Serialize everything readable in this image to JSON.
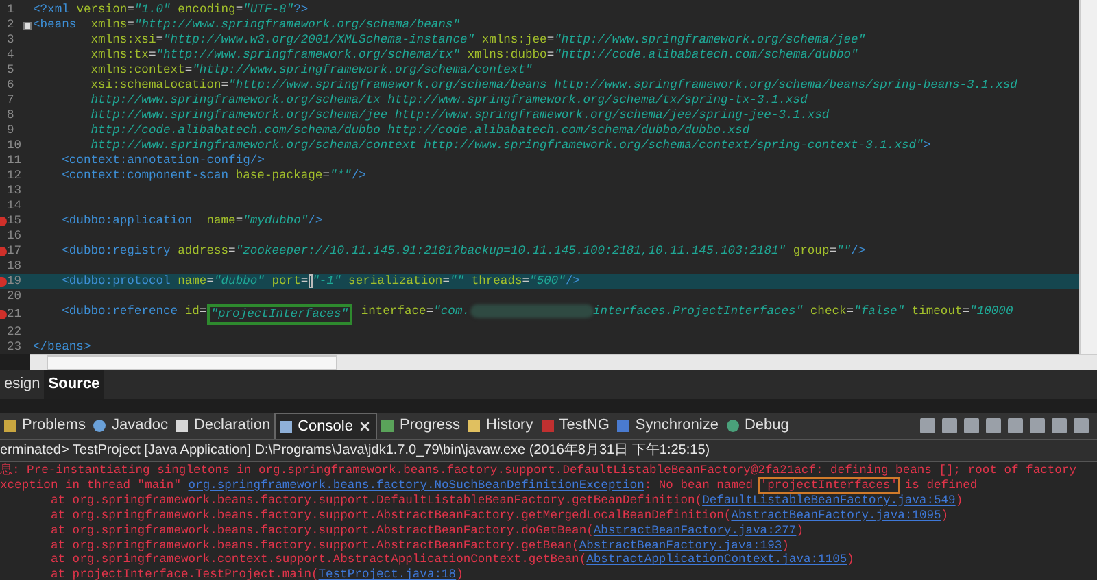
{
  "editor": {
    "lines": [
      {
        "number": "1",
        "error": false,
        "foldable": false,
        "current": false,
        "tokens": [
          {
            "kind": "tag",
            "text": "<?xml"
          },
          {
            "kind": "attr",
            "text": " version"
          },
          {
            "kind": "plain",
            "text": "="
          },
          {
            "kind": "value",
            "text": "\"1.0\""
          },
          {
            "kind": "attr",
            "text": " encoding"
          },
          {
            "kind": "plain",
            "text": "="
          },
          {
            "kind": "value",
            "text": "\"UTF-8\""
          },
          {
            "kind": "tag",
            "text": "?>"
          }
        ]
      },
      {
        "number": "2",
        "error": false,
        "foldable": true,
        "current": false,
        "tokens": [
          {
            "kind": "tag",
            "text": "<beans"
          },
          {
            "kind": "attr",
            "text": "  xmlns"
          },
          {
            "kind": "plain",
            "text": "="
          },
          {
            "kind": "value",
            "text": "\"http://www.springframework.org/schema/beans\""
          }
        ]
      },
      {
        "number": "3",
        "error": false,
        "foldable": false,
        "current": false,
        "tokens": [
          {
            "kind": "attr",
            "text": "        xmlns:xsi"
          },
          {
            "kind": "plain",
            "text": "="
          },
          {
            "kind": "value",
            "text": "\"http://www.w3.org/2001/XMLSchema-instance\""
          },
          {
            "kind": "attr",
            "text": " xmlns:jee"
          },
          {
            "kind": "plain",
            "text": "="
          },
          {
            "kind": "value",
            "text": "\"http://www.springframework.org/schema/jee\""
          }
        ]
      },
      {
        "number": "4",
        "error": false,
        "foldable": false,
        "current": false,
        "tokens": [
          {
            "kind": "attr",
            "text": "        xmlns:tx"
          },
          {
            "kind": "plain",
            "text": "="
          },
          {
            "kind": "value",
            "text": "\"http://www.springframework.org/schema/tx\""
          },
          {
            "kind": "attr",
            "text": " xmlns:dubbo"
          },
          {
            "kind": "plain",
            "text": "="
          },
          {
            "kind": "value",
            "text": "\"http://code.alibabatech.com/schema/dubbo\""
          }
        ]
      },
      {
        "number": "5",
        "error": false,
        "foldable": false,
        "current": false,
        "tokens": [
          {
            "kind": "attr",
            "text": "        xmlns:context"
          },
          {
            "kind": "plain",
            "text": "="
          },
          {
            "kind": "value",
            "text": "\"http://www.springframework.org/schema/context\""
          }
        ]
      },
      {
        "number": "6",
        "error": false,
        "foldable": false,
        "current": false,
        "tokens": [
          {
            "kind": "attr",
            "text": "        xsi:schemaLocation"
          },
          {
            "kind": "plain",
            "text": "="
          },
          {
            "kind": "value",
            "text": "\"http://www.springframework.org/schema/beans http://www.springframework.org/schema/beans/spring-beans-3.1.xsd"
          }
        ]
      },
      {
        "number": "7",
        "error": false,
        "foldable": false,
        "current": false,
        "tokens": [
          {
            "kind": "value",
            "text": "        http://www.springframework.org/schema/tx http://www.springframework.org/schema/tx/spring-tx-3.1.xsd"
          }
        ]
      },
      {
        "number": "8",
        "error": false,
        "foldable": false,
        "current": false,
        "tokens": [
          {
            "kind": "value",
            "text": "        http://www.springframework.org/schema/jee http://www.springframework.org/schema/jee/spring-jee-3.1.xsd"
          }
        ]
      },
      {
        "number": "9",
        "error": false,
        "foldable": false,
        "current": false,
        "tokens": [
          {
            "kind": "value",
            "text": "        http://code.alibabatech.com/schema/dubbo http://code.alibabatech.com/schema/dubbo/dubbo.xsd"
          }
        ]
      },
      {
        "number": "10",
        "error": false,
        "foldable": false,
        "current": false,
        "tokens": [
          {
            "kind": "value",
            "text": "        http://www.springframework.org/schema/context http://www.springframework.org/schema/context/spring-context-3.1.xsd\""
          },
          {
            "kind": "tag",
            "text": ">"
          }
        ]
      },
      {
        "number": "11",
        "error": false,
        "foldable": false,
        "current": false,
        "tokens": [
          {
            "kind": "tag",
            "text": "    <context:annotation-config/>"
          }
        ]
      },
      {
        "number": "12",
        "error": false,
        "foldable": false,
        "current": false,
        "tokens": [
          {
            "kind": "tag",
            "text": "    <context:component-scan"
          },
          {
            "kind": "attr",
            "text": " base-package"
          },
          {
            "kind": "plain",
            "text": "="
          },
          {
            "kind": "value",
            "text": "\"*\""
          },
          {
            "kind": "tag",
            "text": "/>"
          }
        ]
      },
      {
        "number": "13",
        "error": false,
        "foldable": false,
        "current": false
      },
      {
        "number": "14",
        "error": false,
        "foldable": false,
        "current": false
      },
      {
        "number": "15",
        "error": true,
        "foldable": false,
        "current": false,
        "tokens": [
          {
            "kind": "tag",
            "text": "    <dubbo:application"
          },
          {
            "kind": "attr",
            "text": "  name"
          },
          {
            "kind": "plain",
            "text": "="
          },
          {
            "kind": "value",
            "text": "\"mydubbo\""
          },
          {
            "kind": "tag",
            "text": "/>"
          }
        ]
      },
      {
        "number": "16",
        "error": false,
        "foldable": false,
        "current": false
      },
      {
        "number": "17",
        "error": true,
        "foldable": false,
        "current": false,
        "tokens": [
          {
            "kind": "tag",
            "text": "    <dubbo:registry"
          },
          {
            "kind": "attr",
            "text": " address"
          },
          {
            "kind": "plain",
            "text": "="
          },
          {
            "kind": "value",
            "text": "\"zookeeper://10.11.145.91:2181?backup=10.11.145.100:2181,10.11.145.103:2181\""
          },
          {
            "kind": "attr",
            "text": " group"
          },
          {
            "kind": "plain",
            "text": "="
          },
          {
            "kind": "value",
            "text": "\"\""
          },
          {
            "kind": "tag",
            "text": "/>"
          }
        ]
      },
      {
        "number": "18",
        "error": false,
        "foldable": false,
        "current": false
      },
      {
        "number": "19",
        "error": true,
        "foldable": false,
        "current": true,
        "tokens": [
          {
            "kind": "tag",
            "text": "    <dubbo:protocol"
          },
          {
            "kind": "attr",
            "text": " name"
          },
          {
            "kind": "plain",
            "text": "="
          },
          {
            "kind": "value",
            "text": "\"dubbo\""
          },
          {
            "kind": "attr",
            "text": " port"
          },
          {
            "kind": "plain",
            "text": "="
          },
          {
            "kind": "cursor"
          },
          {
            "kind": "value",
            "text": "\"-1\""
          },
          {
            "kind": "attr",
            "text": " serialization"
          },
          {
            "kind": "plain",
            "text": "="
          },
          {
            "kind": "value",
            "text": "\"\""
          },
          {
            "kind": "attr",
            "text": " threads"
          },
          {
            "kind": "plain",
            "text": "="
          },
          {
            "kind": "value",
            "text": "\"500\""
          },
          {
            "kind": "tag",
            "text": "/>"
          }
        ]
      },
      {
        "number": "20",
        "error": false,
        "foldable": false,
        "current": false
      },
      {
        "number": "21",
        "error": true,
        "foldable": false,
        "current": false,
        "tokens": [
          {
            "kind": "tag",
            "text": "    <dubbo:reference"
          },
          {
            "kind": "attr",
            "text": " id"
          },
          {
            "kind": "plain",
            "text": "="
          },
          {
            "kind": "boxed",
            "text": "\"projectInterfaces\""
          },
          {
            "kind": "attr",
            "text": " interface"
          },
          {
            "kind": "plain",
            "text": "="
          },
          {
            "kind": "value",
            "text": "\"com."
          },
          {
            "kind": "redacted"
          },
          {
            "kind": "value",
            "text": "interfaces.ProjectInterfaces\""
          },
          {
            "kind": "attr",
            "text": " check"
          },
          {
            "kind": "plain",
            "text": "="
          },
          {
            "kind": "value",
            "text": "\"false\""
          },
          {
            "kind": "attr",
            "text": " timeout"
          },
          {
            "kind": "plain",
            "text": "="
          },
          {
            "kind": "value",
            "text": "\"10000"
          }
        ]
      },
      {
        "number": "22",
        "error": false,
        "foldable": false,
        "current": false
      },
      {
        "number": "23",
        "error": false,
        "foldable": false,
        "current": false,
        "tokens": [
          {
            "kind": "tag",
            "text": "</beans>"
          }
        ]
      }
    ]
  },
  "editor_tabs": [
    {
      "label": "esign",
      "selected": false
    },
    {
      "label": "Source",
      "selected": true
    }
  ],
  "view_tabs": [
    {
      "label": "Problems",
      "selected": false,
      "closable": false
    },
    {
      "label": "Javadoc",
      "selected": false,
      "closable": false
    },
    {
      "label": "Declaration",
      "selected": false,
      "closable": false
    },
    {
      "label": "Console",
      "selected": true,
      "closable": true
    },
    {
      "label": "Progress",
      "selected": false,
      "closable": false
    },
    {
      "label": "History",
      "selected": false,
      "closable": false
    },
    {
      "label": "TestNG",
      "selected": false,
      "closable": false
    },
    {
      "label": "Synchronize",
      "selected": false,
      "closable": false
    },
    {
      "label": "Debug",
      "selected": false,
      "closable": false
    }
  ],
  "console": {
    "status": "erminated> TestProject [Java Application] D:\\Programs\\Java\\jdk1.7.0_79\\bin\\javaw.exe (2016年8月31日 下午1:25:15)",
    "lines": [
      [
        {
          "kind": "text",
          "text": "息: Pre-instantiating singletons in org.springframework.beans.factory.support.DefaultListableBeanFactory@2fa21acf: defining beans []; root of factory"
        }
      ],
      [
        {
          "kind": "text",
          "text": "xception in thread \"main\" "
        },
        {
          "kind": "link",
          "text": "org.springframework.beans.factory.NoSuchBeanDefinitionException"
        },
        {
          "kind": "text",
          "text": ": No bean named "
        },
        {
          "kind": "boxed",
          "text": "'projectInterfaces'"
        },
        {
          "kind": "text",
          "text": " is defined"
        }
      ],
      [
        {
          "kind": "text",
          "text": "\tat org.springframework.beans.factory.support.DefaultListableBeanFactory.getBeanDefinition("
        },
        {
          "kind": "link",
          "text": "DefaultListableBeanFactory.java:549"
        },
        {
          "kind": "text",
          "text": ")"
        }
      ],
      [
        {
          "kind": "text",
          "text": "\tat org.springframework.beans.factory.support.AbstractBeanFactory.getMergedLocalBeanDefinition("
        },
        {
          "kind": "link",
          "text": "AbstractBeanFactory.java:1095"
        },
        {
          "kind": "text",
          "text": ")"
        }
      ],
      [
        {
          "kind": "text",
          "text": "\tat org.springframework.beans.factory.support.AbstractBeanFactory.doGetBean("
        },
        {
          "kind": "link",
          "text": "AbstractBeanFactory.java:277"
        },
        {
          "kind": "text",
          "text": ")"
        }
      ],
      [
        {
          "kind": "text",
          "text": "\tat org.springframework.beans.factory.support.AbstractBeanFactory.getBean("
        },
        {
          "kind": "link",
          "text": "AbstractBeanFactory.java:193"
        },
        {
          "kind": "text",
          "text": ")"
        }
      ],
      [
        {
          "kind": "text",
          "text": "\tat org.springframework.context.support.AbstractApplicationContext.getBean("
        },
        {
          "kind": "link",
          "text": "AbstractApplicationContext.java:1105"
        },
        {
          "kind": "text",
          "text": ")"
        }
      ],
      [
        {
          "kind": "text",
          "text": "\tat projectInterface.TestProject.main("
        },
        {
          "kind": "link",
          "text": "TestProject.java:18"
        },
        {
          "kind": "text",
          "text": ")"
        }
      ]
    ]
  }
}
